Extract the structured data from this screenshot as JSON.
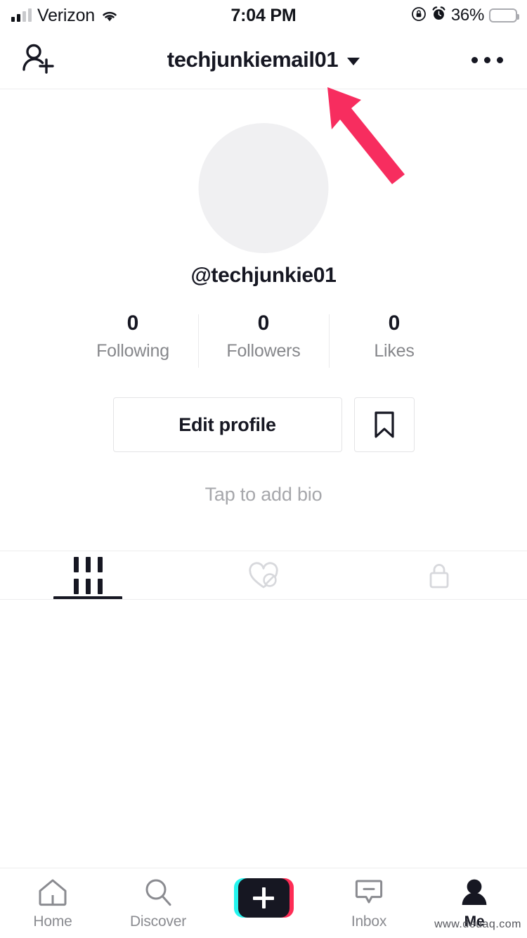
{
  "status_bar": {
    "carrier": "Verizon",
    "signal_bars_filled": 2,
    "signal_bars_total": 4,
    "wifi_icon": "wifi-icon",
    "time": "7:04 PM",
    "rotation_lock_icon": "rotation-lock-icon",
    "alarm_icon": "alarm-clock-icon",
    "battery_percent": "36%",
    "battery_level": 36,
    "battery_color": "#FFD426"
  },
  "header": {
    "add_friend_icon": "add-friend-icon",
    "username": "techjunkiemail01",
    "dropdown_icon": "chevron-down-icon",
    "more_icon": "more-options-icon"
  },
  "profile": {
    "avatar_placeholder_color": "#f0f0f2",
    "handle": "@techjunkie01",
    "stats": [
      {
        "count": "0",
        "label": "Following"
      },
      {
        "count": "0",
        "label": "Followers"
      },
      {
        "count": "0",
        "label": "Likes"
      }
    ],
    "edit_profile_label": "Edit profile",
    "bookmark_icon": "bookmark-icon",
    "bio_placeholder": "Tap to add bio"
  },
  "content_tabs": [
    {
      "name": "videos",
      "icon": "grid-icon",
      "active": true
    },
    {
      "name": "liked",
      "icon": "heart-slash-icon",
      "active": false
    },
    {
      "name": "private",
      "icon": "lock-icon",
      "active": false
    }
  ],
  "bottom_nav": [
    {
      "label": "Home",
      "icon": "home-icon",
      "active": false
    },
    {
      "label": "Discover",
      "icon": "search-icon",
      "active": false
    },
    {
      "label": "",
      "icon": "create-plus-icon",
      "active": false
    },
    {
      "label": "Inbox",
      "icon": "inbox-icon",
      "active": false
    },
    {
      "label": "Me",
      "icon": "person-icon",
      "active": true
    }
  ],
  "annotation": {
    "arrow_color": "#F72D5F",
    "arrow_name": "pink-annotation-arrow"
  },
  "watermark": {
    "text": "www.deuaq.com"
  }
}
